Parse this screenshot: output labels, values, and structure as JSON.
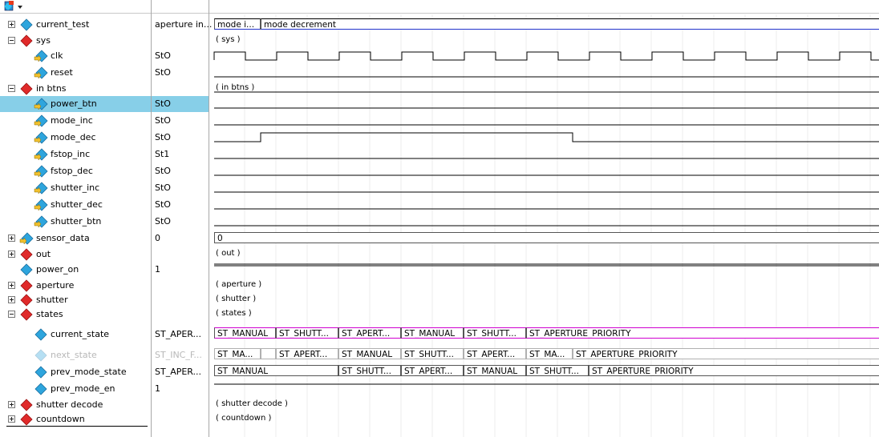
{
  "colors": {
    "selected_row": "#87cfe8",
    "bus_blue": "#2233cc",
    "bus_pink": "#d000d0",
    "grid": "#e6e6e6"
  },
  "toolbar": {
    "icon": "wave-add-icon"
  },
  "rows": [
    {
      "name": "current_test",
      "value": "aperture in...",
      "icon": "diamond-blue",
      "expander": "plus"
    },
    {
      "name": "sys",
      "value": "",
      "icon": "diamond-red",
      "expander": "minus",
      "group": "( sys )"
    },
    {
      "name": "clk",
      "value": "StO",
      "icon": "diamond-blue-arrow"
    },
    {
      "name": "reset",
      "value": "StO",
      "icon": "diamond-blue-arrow"
    },
    {
      "name": "in btns",
      "value": "",
      "icon": "diamond-red",
      "expander": "minus",
      "group": "( in btns )"
    },
    {
      "name": "power_btn",
      "value": "StO",
      "icon": "diamond-blue-arrow",
      "selected": true
    },
    {
      "name": "mode_inc",
      "value": "StO",
      "icon": "diamond-blue-arrow"
    },
    {
      "name": "mode_dec",
      "value": "StO",
      "icon": "diamond-blue-arrow"
    },
    {
      "name": "fstop_inc",
      "value": "St1",
      "icon": "diamond-blue-arrow"
    },
    {
      "name": "fstop_dec",
      "value": "StO",
      "icon": "diamond-blue-arrow"
    },
    {
      "name": "shutter_inc",
      "value": "StO",
      "icon": "diamond-blue-arrow"
    },
    {
      "name": "shutter_dec",
      "value": "StO",
      "icon": "diamond-blue-arrow"
    },
    {
      "name": "shutter_btn",
      "value": "StO",
      "icon": "diamond-blue-arrow"
    },
    {
      "name": "sensor_data",
      "value": "0",
      "icon": "diamond-blue-arrow",
      "expander": "plus"
    },
    {
      "name": "out",
      "value": "",
      "icon": "diamond-red",
      "expander": "plus",
      "group": "( out )"
    },
    {
      "name": "power_on",
      "value": "1",
      "icon": "diamond-blue"
    },
    {
      "name": "aperture",
      "value": "",
      "icon": "diamond-red",
      "expander": "plus",
      "group": "( aperture )"
    },
    {
      "name": "shutter",
      "value": "",
      "icon": "diamond-red",
      "expander": "plus",
      "group": "( shutter )"
    },
    {
      "name": "states",
      "value": "",
      "icon": "diamond-red",
      "expander": "minus",
      "group": "( states )"
    },
    {
      "name": "current_state",
      "value": "ST_APER...",
      "icon": "diamond-blue"
    },
    {
      "name": "next_state",
      "value": "ST_INC_F...",
      "icon": "diamond-blue",
      "dim": true
    },
    {
      "name": "prev_mode_state",
      "value": "ST_APER...",
      "icon": "diamond-blue"
    },
    {
      "name": "prev_mode_en",
      "value": "1",
      "icon": "diamond-blue"
    },
    {
      "name": "shutter decode",
      "value": "",
      "icon": "diamond-red",
      "expander": "plus",
      "group": "( shutter decode )"
    },
    {
      "name": "countdown",
      "value": "",
      "icon": "diamond-red",
      "expander": "plus",
      "group": "( countdown )"
    }
  ],
  "buses": {
    "current_test": [
      "mode i...",
      "mode decrement"
    ],
    "sensor_data": [
      "0"
    ],
    "current_state": [
      "ST_MANUAL",
      "ST_SHUTT...",
      "ST_APERT...",
      "ST_MANUAL",
      "ST_SHUTT...",
      "ST_APERTURE_PRIORITY"
    ],
    "next_state": [
      "ST_MA...",
      "",
      "ST_APERT...",
      "ST_MANUAL",
      "ST_SHUTT...",
      "ST_APERT...",
      "ST_MA...",
      "ST_APERTURE_PRIORITY"
    ],
    "prev_mode_state": [
      "ST_MANUAL",
      "ST_SHUTT...",
      "ST_APERT...",
      "ST_MANUAL",
      "ST_SHUTT...",
      "ST_APERTURE_PRIORITY"
    ]
  }
}
